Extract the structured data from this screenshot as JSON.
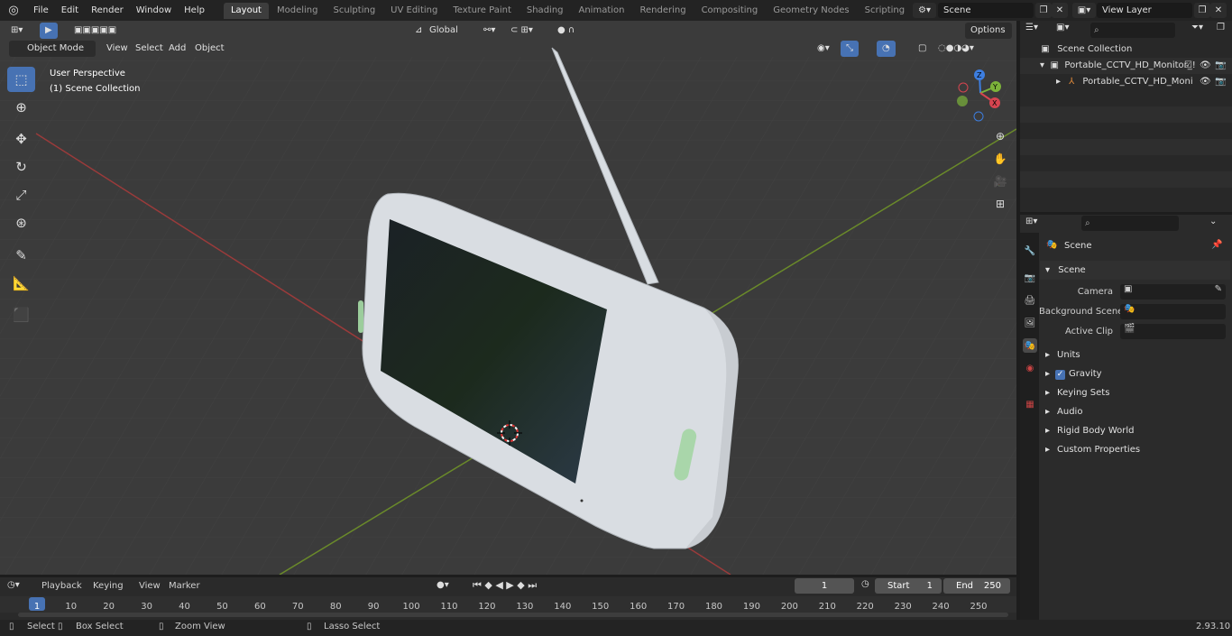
{
  "topbar": {
    "menus": [
      "File",
      "Edit",
      "Render",
      "Window",
      "Help"
    ],
    "workspaces": [
      "Layout",
      "Modeling",
      "Sculpting",
      "UV Editing",
      "Texture Paint",
      "Shading",
      "Animation",
      "Rendering",
      "Compositing",
      "Geometry Nodes",
      "Scripting"
    ],
    "active_workspace": "Layout",
    "add_tab": "+",
    "scene_name": "Scene",
    "view_layer_name": "View Layer"
  },
  "viewport": {
    "mode": "Object Mode",
    "menus": [
      "View",
      "Select",
      "Add",
      "Object"
    ],
    "transform_orientation": "Global",
    "options_label": "Options",
    "info_line1": "User Perspective",
    "info_line2": "(1) Scene Collection",
    "gizmo": {
      "z": "Z",
      "y": "Y",
      "x": "X"
    }
  },
  "outliner": {
    "root": "Scene Collection",
    "items": [
      {
        "label": "Portable_CCTV_HD_Monitor_!"
      },
      {
        "label": "Portable_CCTV_HD_Moni"
      }
    ]
  },
  "properties": {
    "context": "Scene",
    "panel_title": "Scene",
    "camera_label": "Camera",
    "background_scene_label": "Background Scene",
    "active_clip_label": "Active Clip",
    "sections": [
      "Units",
      "Gravity",
      "Keying Sets",
      "Audio",
      "Rigid Body World",
      "Custom Properties"
    ],
    "gravity_enabled": true
  },
  "timeline": {
    "menus": [
      "Playback",
      "Keying",
      "View",
      "Marker"
    ],
    "current_frame": "1",
    "start_label": "Start",
    "start_value": "1",
    "end_label": "End",
    "end_value": "250",
    "ticks": [
      "1",
      "10",
      "20",
      "30",
      "40",
      "50",
      "60",
      "70",
      "80",
      "90",
      "100",
      "110",
      "120",
      "130",
      "140",
      "150",
      "160",
      "170",
      "180",
      "190",
      "200",
      "210",
      "220",
      "230",
      "240",
      "250"
    ]
  },
  "statusbar": {
    "select": "Select",
    "box_select": "Box Select",
    "zoom_view": "Zoom View",
    "lasso_select": "Lasso Select",
    "version": "2.93.10"
  }
}
